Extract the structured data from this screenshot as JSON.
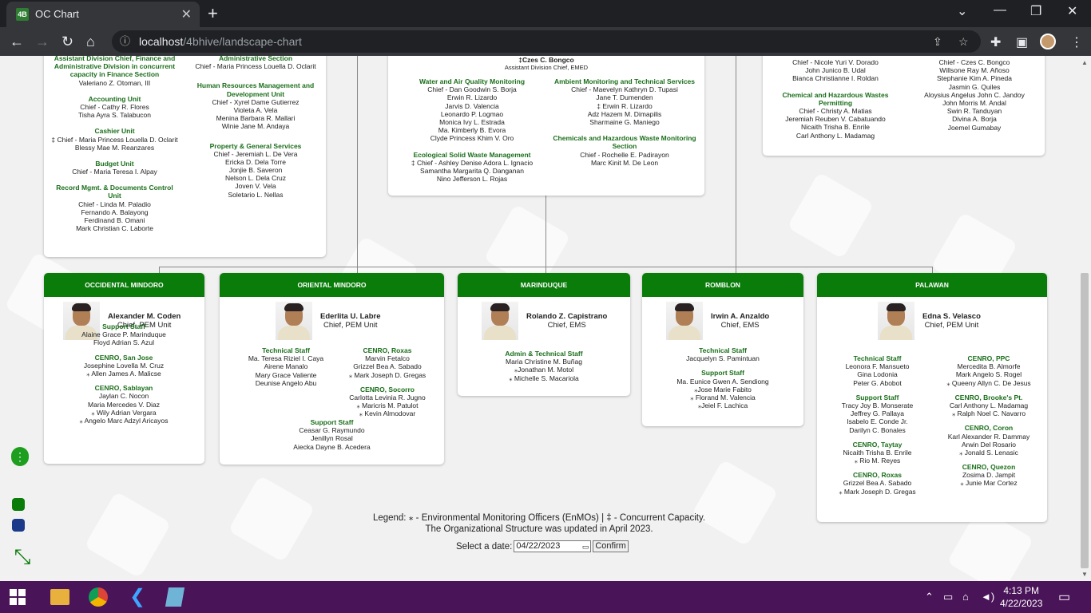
{
  "browser": {
    "tab_title": "OC Chart",
    "url_host": "localhost",
    "url_path": "/4bhive/landscape-chart"
  },
  "top_left_card": {
    "left_sections": [
      {
        "title": "Assistant Division Chief, Finance and Administrative Division in concurrent capacity in Finance Section",
        "lines": [
          "Valeriano Z. Otoman, III"
        ]
      },
      {
        "title": "Accounting Unit",
        "lines": [
          "Chief - Cathy R. Flores",
          "Tisha Ayra S. Talabucon"
        ]
      },
      {
        "title": "Cashier Unit",
        "lines": [
          "‡ Chief - Maria Princess Louella D. Oclarit",
          "Blessy Mae M. Reanzares"
        ]
      },
      {
        "title": "Budget Unit",
        "lines": [
          "Chief - Maria Teresa I. Alpay"
        ]
      },
      {
        "title": "Record Mgmt. & Documents Control Unit",
        "lines": [
          "Chief - Linda M. Paladio",
          "Fernando A. Balayong",
          "Ferdinand B. Omani",
          "Mark Christian C. Laborte"
        ]
      }
    ],
    "right_sections": [
      {
        "title": "Administrative Section",
        "lines": [
          "Chief - Maria Princess Louella D. Oclarit"
        ]
      },
      {
        "title": "Human Resources Management and Development Unit",
        "lines": [
          "Chief - Xyrel Dame Gutierrez",
          "Violeta A. Vela",
          "Menina Barbara R. Mallari",
          "Winie Jane M. Andaya"
        ]
      },
      {
        "title": "Property & General Services",
        "lines": [
          "Chief - Jeremiah L. De Vera",
          "Ericka D. Dela Torre",
          "Jonjie B. Saveron",
          "Nelson L. Dela Cruz",
          "Joven V. Vela",
          "Soletario L. Nellas"
        ]
      }
    ]
  },
  "top_middle_card": {
    "head_name": "‡Czes C. Bongco",
    "head_title": "Assistant Division Chief, EMED",
    "left_sections": [
      {
        "title": "Water and Air Quality Monitoring",
        "lines": [
          "Chief - Dan Goodwin S. Borja",
          "Erwin R. Lizardo",
          "Jarvis D. Valencia",
          "Leonardo P. Logmao",
          "Monica Ivy L. Estrada",
          "Ma. Kimberly B. Evora",
          "Clyde Princess Khim V. Oro"
        ]
      },
      {
        "title": "Ecological Solid Waste Management",
        "lines": [
          "‡ Chief - Ashley Denise Adora L. Ignacio",
          "Samantha Margarita Q. Danganan",
          "Nino Jefferson L. Rojas"
        ]
      }
    ],
    "right_sections": [
      {
        "title": "Ambient Monitoring and Technical Services",
        "lines": [
          "Chief - Maevelyn Kathryn D. Tupasi",
          "Jane T. Dumenden",
          "‡ Erwin R. Lizardo",
          "Adz Hazem M. Dimapilis",
          "Sharmaine G. Maniego"
        ]
      },
      {
        "title": "Chemicals and Hazardous Waste Monitoring Section",
        "lines": [
          "Chief - Rochelle E. Padirayon",
          "Marc Kinit M. De Leon"
        ]
      }
    ]
  },
  "top_right_card": {
    "left_sections": [
      {
        "title": "",
        "lines": [
          "Chief - Nicole Yuri V. Dorado",
          "John Junico B. Udal",
          "Bianca Christianne I. Roldan"
        ]
      },
      {
        "title": "Chemical and Hazardous Wastes Permitting",
        "lines": [
          "Chief - Christy A. Matias",
          "Jeremiah Reuben V. Cabatuando",
          "Nicaith Trisha B. Enrile",
          "Carl Anthony L. Madamag"
        ]
      }
    ],
    "right_sections": [
      {
        "title": "",
        "lines": [
          "Chief - Czes C. Bongco",
          "Willsone Ray M. Añoso",
          "Stephanie Kim A. Pineda",
          "Jasmin G. Quiles",
          "Aloysius Angelus John C. Jandoy",
          "John Morris M. Andal",
          "Swin R. Tanduyan",
          "Divina A. Borja",
          "Joemel Gumabay"
        ]
      }
    ]
  },
  "provinces": [
    {
      "name": "OCCIDENTAL MINDORO",
      "person": "Alexander M. Coden",
      "title": "Chief, PEM Unit",
      "left_sections": [
        {
          "title": "Support Staff",
          "lines": [
            "Alaine Grace P. Marinduque",
            "Floyd Adrian S. Azul"
          ]
        },
        {
          "title": "CENRO, San Jose",
          "lines": [
            "Josephine Lovella M. Cruz",
            "⁎ Allen James A. Malicse"
          ]
        },
        {
          "title": "CENRO, Sablayan",
          "lines": [
            "Jaylan C. Nocon",
            "Maria Mercedes V. Diaz",
            "⁎ Wily Adrian Vergara",
            "⁎ Angelo Marc Adzyl Aricayos"
          ]
        }
      ],
      "right_sections": []
    },
    {
      "name": "ORIENTAL MINDORO",
      "person": "Ederlita U. Labre",
      "title": "Chief, PEM Unit",
      "left_sections": [
        {
          "title": "Technical Staff",
          "lines": [
            "Ma. Teresa Riziel I. Caya",
            "Airene Manalo",
            "Mary Grace Valiente",
            "Deunise Angelo Abu"
          ]
        }
      ],
      "right_sections": [
        {
          "title": "CENRO, Roxas",
          "lines": [
            "Marvin Fetalco",
            "Grizzel Bea A. Sabado",
            "⁎ Mark Joseph D. Gregas"
          ]
        },
        {
          "title": "CENRO, Socorro",
          "lines": [
            "Carlotta Levinia R. Jugno",
            "⁎ Maricris M. Patulot",
            "⁎ Kevin Almodovar"
          ]
        }
      ],
      "bottom_sections": [
        {
          "title": "Support Staff",
          "lines": [
            "Ceasar G. Raymundo",
            "Jenillyn Rosal",
            "Aiecka Dayne B. Acedera"
          ]
        }
      ]
    },
    {
      "name": "MARINDUQUE",
      "person": "Rolando Z. Capistrano",
      "title": "Chief, EMS",
      "left_sections": [
        {
          "title": "Admin & Technical Staff",
          "lines": [
            "Maria Christine M. Buñag",
            "⁎Jonathan M. Motol",
            "⁎ Michelle S. Macariola"
          ]
        }
      ],
      "right_sections": []
    },
    {
      "name": "ROMBLON",
      "person": "Irwin A. Anzaldo",
      "title": "Chief, EMS",
      "left_sections": [
        {
          "title": "Technical Staff",
          "lines": [
            "Jacquelyn S. Pamintuan"
          ]
        },
        {
          "title": "Support Staff",
          "lines": [
            "Ma. Eunice Gwen A. Sendiong",
            "⁎Jose Marie Fabito",
            "⁎ Florand M. Valencia",
            "⁎Jeiel F. Lachica"
          ]
        }
      ],
      "right_sections": []
    },
    {
      "name": "PALAWAN",
      "person": "Edna S. Velasco",
      "title": "Chief, PEM Unit",
      "left_sections": [
        {
          "title": "Technical Staff",
          "lines": [
            "Leonora F. Mansueto",
            "Gina Lodonia",
            "Peter G. Abobot"
          ]
        },
        {
          "title": "Support Staff",
          "lines": [
            "Tracy Joy B. Monserate",
            "Jeffrey G. Pallaya",
            "Isabelo E. Conde Jr.",
            "Darilyn C. Bonales"
          ]
        },
        {
          "title": "CENRO, Taytay",
          "lines": [
            "Nicaith Trisha B. Enrile",
            "⁎ Rio M. Reyes"
          ]
        },
        {
          "title": "CENRO, Roxas",
          "lines": [
            "Grizzel Bea A. Sabado",
            "⁎ Mark Joseph D. Gregas"
          ]
        }
      ],
      "right_sections": [
        {
          "title": "CENRO, PPC",
          "lines": [
            "Mercedita B. Almorfe",
            "Mark Angelo S. Rogel",
            "⁎ Queeny Allyn C. De Jesus"
          ]
        },
        {
          "title": "CENRO, Brooke's Pt.",
          "lines": [
            "Carl Anthony L. Madamag",
            "⁎ Ralph Noel C. Navarro"
          ]
        },
        {
          "title": "CENRO, Coron",
          "lines": [
            "Karl Alexander R. Dammay",
            "Arwin Del Rosario",
            "⁎ Jonald S. Lenasic"
          ]
        },
        {
          "title": "CENRO, Quezon",
          "lines": [
            "Zosima D. Jampit",
            "⁎ Junie Mar Cortez"
          ]
        }
      ]
    }
  ],
  "legend": {
    "label": "Legend:",
    "text": "⁎ - Environmental Monitoring Officers (EnMOs)  |  ‡ - Concurrent Capacity.",
    "updated": "The Organizational Structure was updated in April 2023."
  },
  "date_picker": {
    "label": "Select a date:",
    "value": "04/22/2023",
    "confirm": "Confirm"
  },
  "taskbar": {
    "time": "4:13 PM",
    "date": "4/22/2023"
  },
  "colors": {
    "header_green": "#0a7c0a",
    "title_green": "#1a6e1a",
    "taskbar": "#4a1459"
  }
}
